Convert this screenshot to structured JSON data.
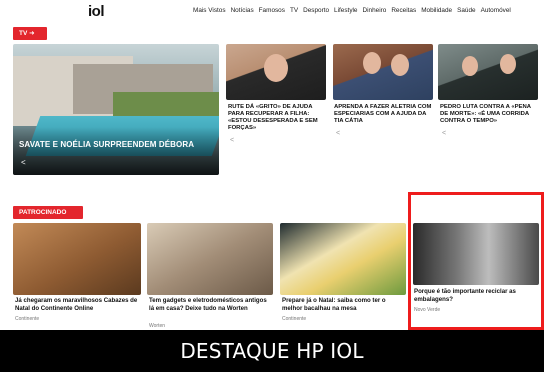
{
  "header": {
    "logo": "iol",
    "nav": [
      "Mais Vistos",
      "Notícias",
      "Famosos",
      "TV",
      "Desporto",
      "Lifestyle",
      "Dinheiro",
      "Receitas",
      "Mobilidade",
      "Saúde",
      "Automóvel"
    ]
  },
  "tv_section": {
    "tag": "TV ➜",
    "hero": {
      "title": "SAVATE E NOÉLIA SURPREENDEM DÉBORA"
    },
    "cards": [
      {
        "title": "RUTE DÁ «GRITO» DE AJUDA PARA RECUPERAR A FILHA: «ESTOU DESESPERADA E SEM FORÇAS»"
      },
      {
        "title": "APRENDA A FAZER ALETRIA COM ESPECIARIAS COM A AJUDA DA TIA CÁTIA"
      },
      {
        "title": "PEDRO LUTA CONTRA A «PENA DE MORTE»: «É UMA CORRIDA CONTRA O TEMPO»"
      }
    ]
  },
  "sponsored_section": {
    "tag": "PATROCINADO",
    "cards": [
      {
        "title": "Já chegaram os maravilhosos Cabazes de Natal do Continente Online",
        "source": "Continente"
      },
      {
        "title": "Tem gadgets e eletrodomésticos antigos lá em casa? Deixe tudo na Worten",
        "source": "Worten"
      },
      {
        "title": "Prepare já o Natal: saiba como ter o melhor bacalhau na mesa",
        "source": "Continente"
      },
      {
        "title": "Porque é tão importante reciclar as embalagens?",
        "source": "Novo Verde"
      }
    ]
  },
  "caption_banner": "DESTAQUE HP IOL",
  "colors": {
    "accent": "#e3262d",
    "highlight_border": "#ee1c1c",
    "banner_bg": "#000000"
  }
}
